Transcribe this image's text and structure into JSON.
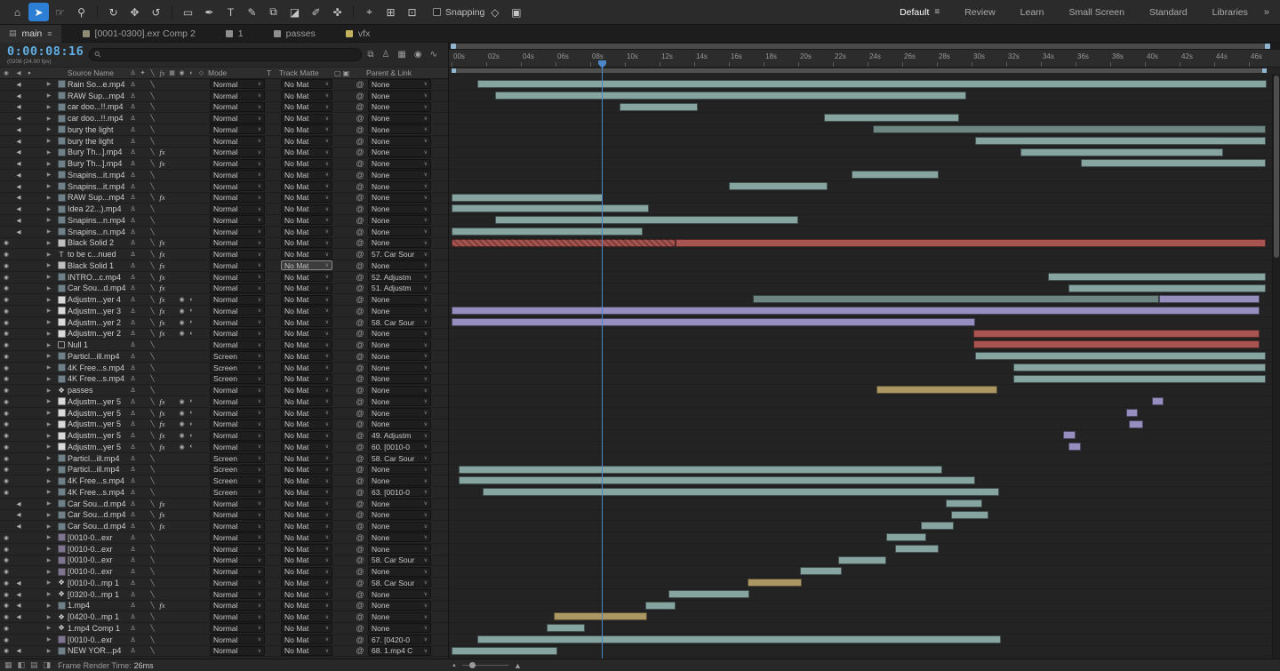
{
  "toolbar": {
    "snapping_label": "Snapping",
    "snapping_checked": false,
    "menu_glyph": "≡",
    "overflow_icon": "»",
    "tools": [
      {
        "name": "home-tool",
        "glyph": "⌂"
      },
      {
        "name": "selection-tool",
        "glyph": "➤",
        "active": true
      },
      {
        "name": "hand-tool",
        "glyph": "☞"
      },
      {
        "name": "zoom-tool",
        "glyph": "⚲"
      },
      {
        "sep": true
      },
      {
        "name": "orbit-camera-tool",
        "glyph": "↻"
      },
      {
        "name": "pan-camera-tool",
        "glyph": "✥"
      },
      {
        "name": "dolly-camera-tool",
        "glyph": "↺"
      },
      {
        "sep": true
      },
      {
        "name": "rectangle-tool",
        "glyph": "▭"
      },
      {
        "name": "pen-tool",
        "glyph": "✒"
      },
      {
        "name": "type-tool",
        "glyph": "T"
      },
      {
        "name": "brush-tool",
        "glyph": "✎"
      },
      {
        "name": "clone-stamp-tool",
        "glyph": "⧉"
      },
      {
        "name": "eraser-tool",
        "glyph": "◪"
      },
      {
        "name": "roto-brush-tool",
        "glyph": "✐"
      },
      {
        "name": "puppet-pin-tool",
        "glyph": "✜"
      },
      {
        "sep": true
      },
      {
        "name": "axis-mode-local",
        "glyph": "⌖"
      },
      {
        "name": "axis-mode-world",
        "glyph": "⊞"
      },
      {
        "name": "axis-mode-view",
        "glyph": "⊡"
      }
    ],
    "post_icons": [
      {
        "name": "snapping-options-icon-1",
        "glyph": "◇"
      },
      {
        "name": "snapping-options-icon-2",
        "glyph": "▣"
      }
    ],
    "workspaces": [
      {
        "label": "Default",
        "active": true
      },
      {
        "label": "Review"
      },
      {
        "label": "Learn"
      },
      {
        "label": "Small Screen"
      },
      {
        "label": "Standard"
      },
      {
        "label": "Libraries"
      }
    ]
  },
  "tabs": {
    "active": {
      "icon_glyph": "▤",
      "label": "main",
      "menu_glyph": "≡"
    },
    "items": [
      {
        "label": "[0001-0300].exr Comp 2",
        "color": "#8F8A74"
      },
      {
        "label": "1",
        "color": "#8F8F8F"
      },
      {
        "label": "passes",
        "color": "#8F8F8F"
      },
      {
        "label": "vfx",
        "color": "#C4B35E"
      }
    ]
  },
  "search": {
    "placeholder": "",
    "magnifier_glyph": "⚲"
  },
  "panel_top_icons": [
    {
      "name": "mini-flowchart-icon",
      "glyph": "⧉"
    },
    {
      "name": "hide-shy-layers-icon",
      "glyph": "♙"
    },
    {
      "name": "frame-blending-icon",
      "glyph": "▦"
    },
    {
      "name": "motion-blur-icon",
      "glyph": "◉"
    },
    {
      "name": "graph-editor-icon",
      "glyph": "∿"
    }
  ],
  "columns": {
    "av_icons": [
      "◉",
      "◀",
      "●"
    ],
    "eye_glyph": "◉",
    "audio_glyph": "◀",
    "source_name": "Source Name",
    "switch_glyphs": {
      "shy": "♙",
      "collapse": "✦",
      "quality": "╲",
      "fx": "fx",
      "frame_blend": "▦",
      "motion_blur": "◉",
      "adjustment": "◐",
      "threed": "◇"
    },
    "mode": "Mode",
    "t": "T",
    "track_matte": "Track Matte",
    "matte_toggle_icons": [
      "▢",
      "▣"
    ],
    "parent_link": "Parent & Link"
  },
  "defaults": {
    "mode": "Normal",
    "track_matte": "No Mat",
    "parent": "None"
  },
  "palette": {
    "clip_green": "#87A5A0",
    "clip_green_dark": "#6E8682",
    "clip_red": "#A85450",
    "clip_purple": "#958EBE",
    "clip_tan": "#AB9763",
    "timecode_blue": "#61AEE3",
    "playhead_blue": "#4E87C7",
    "tool_active_blue": "#2D7FD6"
  },
  "layer_icon_styles": {
    "video": {
      "color": "#6F8089"
    },
    "footage": {
      "color": "#80758F"
    },
    "solid": {
      "color": "#BFBFBF"
    },
    "adjustment": {
      "color": "#DADADA"
    },
    "null": {
      "outline": true
    },
    "text": {
      "glyph": "T"
    },
    "comp": {
      "glyph": "❖"
    }
  },
  "timeline": {
    "timecode": "0:00:08:16",
    "frame_info": "(0208 (24.00 fps)",
    "playhead_seconds": 8.67,
    "duration_seconds": 47,
    "ruler_labels": [
      "00s",
      "02s",
      "04s",
      "06s",
      "08s",
      "10s",
      "12s",
      "14s",
      "16s",
      "18s",
      "20s",
      "22s",
      "24s",
      "26s",
      "28s",
      "30s",
      "32s",
      "34s",
      "36s",
      "38s",
      "40s",
      "42s",
      "44s",
      "46s"
    ],
    "layers": [
      {
        "name": "Rain So...e.mp4",
        "icon": "video",
        "audio": true,
        "clips": [
          {
            "start": 1.5,
            "end": 47,
            "color": "green"
          }
        ]
      },
      {
        "name": "RAW Sup...mp4",
        "icon": "video",
        "audio": true,
        "clips": [
          {
            "start": 2.5,
            "end": 29.7,
            "color": "green"
          }
        ]
      },
      {
        "name": "car doo...!!.mp4",
        "icon": "video",
        "audio": true,
        "clips": [
          {
            "start": 9.7,
            "end": 14.2,
            "color": "green"
          }
        ]
      },
      {
        "name": "car doo...!!.mp4",
        "icon": "video",
        "audio": true,
        "clips": [
          {
            "start": 21.5,
            "end": 29.3,
            "color": "green"
          }
        ]
      },
      {
        "name": "bury the light",
        "icon": "video",
        "audio": true,
        "clips": [
          {
            "start": 24.3,
            "end": 47,
            "color": "green_dark"
          }
        ]
      },
      {
        "name": "bury the light",
        "icon": "video",
        "audio": true,
        "clips": [
          {
            "start": 30.2,
            "end": 47,
            "color": "green"
          }
        ]
      },
      {
        "name": "Bury Th...].mp4",
        "icon": "video",
        "audio": true,
        "fx": true,
        "clips": [
          {
            "start": 32.8,
            "end": 44.5,
            "color": "green"
          }
        ]
      },
      {
        "name": "Bury Th...].mp4",
        "icon": "video",
        "audio": true,
        "fx": true,
        "clips": [
          {
            "start": 36.3,
            "end": 47,
            "color": "green"
          }
        ]
      },
      {
        "name": "Snapins...it.mp4",
        "icon": "video",
        "audio": true,
        "clips": [
          {
            "start": 23.1,
            "end": 28.1,
            "color": "green"
          }
        ]
      },
      {
        "name": "Snapins...it.mp4",
        "icon": "video",
        "audio": true,
        "clips": [
          {
            "start": 16,
            "end": 21.7,
            "color": "green"
          }
        ]
      },
      {
        "name": "RAW Sup...mp4",
        "icon": "video",
        "audio": true,
        "fx": true,
        "clips": [
          {
            "start": 0,
            "end": 8.7,
            "color": "green"
          }
        ]
      },
      {
        "name": "Idea 22...).mp4",
        "icon": "video",
        "audio": true,
        "clips": [
          {
            "start": 0,
            "end": 11.4,
            "color": "green"
          }
        ]
      },
      {
        "name": "Snapins...n.mp4",
        "icon": "video",
        "audio": true,
        "clips": [
          {
            "start": 2.5,
            "end": 20,
            "color": "green"
          }
        ]
      },
      {
        "name": "Snapins...n.mp4",
        "icon": "video",
        "audio": true,
        "clips": [
          {
            "start": 0,
            "end": 11,
            "color": "green"
          }
        ]
      },
      {
        "name": "Black Solid 2",
        "icon": "solid",
        "eye": true,
        "fx": true,
        "clips": [
          {
            "start": 0,
            "end": 12.9,
            "color": "red",
            "hat ched": false,
            "hatched": true
          },
          {
            "start": 12.9,
            "end": 47,
            "color": "red"
          }
        ]
      },
      {
        "name": "to be c...nued",
        "icon": "text",
        "eye": true,
        "fx": true,
        "parent": "57. Car Sour",
        "clips": []
      },
      {
        "name": "Black Solid 1",
        "icon": "solid",
        "eye": true,
        "fx": true,
        "trkmat_highlight": true,
        "clips": []
      },
      {
        "name": "INTRO...c.mp4",
        "icon": "video",
        "eye": true,
        "fx": true,
        "parent": "52. Adjustm",
        "clips": [
          {
            "start": 34.4,
            "end": 47,
            "color": "green"
          }
        ]
      },
      {
        "name": "Car Sou...d.mp4",
        "icon": "video",
        "eye": true,
        "fx": true,
        "parent": "51. Adjustm",
        "clips": [
          {
            "start": 35.6,
            "end": 47,
            "color": "green"
          }
        ]
      },
      {
        "name": "Adjustm...yer 4",
        "icon": "adjustment",
        "eye": true,
        "fx": true,
        "adjustment": true,
        "clips": [
          {
            "start": 17.4,
            "end": 40.8,
            "color": "green_dark"
          },
          {
            "start": 40.8,
            "end": 46.6,
            "color": "purple"
          }
        ]
      },
      {
        "name": "Adjustm...yer 3",
        "icon": "adjustment",
        "eye": true,
        "fx": true,
        "adjustment": true,
        "clips": [
          {
            "start": 0,
            "end": 46.6,
            "color": "purple"
          }
        ]
      },
      {
        "name": "Adjustm...yer 2",
        "icon": "adjustment",
        "eye": true,
        "fx": true,
        "adjustment": true,
        "parent": "58. Car Sour",
        "clips": [
          {
            "start": 0,
            "end": 30.2,
            "color": "purple"
          }
        ]
      },
      {
        "name": "Adjustm...yer 2",
        "icon": "adjustment",
        "eye": true,
        "fx": true,
        "adjustment": true,
        "clips": [
          {
            "start": 30.1,
            "end": 46.6,
            "color": "red"
          }
        ]
      },
      {
        "name": "Null 1",
        "icon": "null",
        "eye": true,
        "clips": [
          {
            "start": 30.1,
            "end": 46.6,
            "color": "red"
          }
        ]
      },
      {
        "name": "Particl...ill.mp4",
        "icon": "video",
        "eye": true,
        "mode": "Screen",
        "clips": [
          {
            "start": 30.2,
            "end": 47,
            "color": "green"
          }
        ]
      },
      {
        "name": "4K Free...s.mp4",
        "icon": "video",
        "eye": true,
        "mode": "Screen",
        "clips": [
          {
            "start": 32.4,
            "end": 47,
            "color": "green"
          }
        ]
      },
      {
        "name": "4K Free...s.mp4",
        "icon": "video",
        "eye": true,
        "mode": "Screen",
        "clips": [
          {
            "start": 32.4,
            "end": 47,
            "color": "green"
          }
        ]
      },
      {
        "name": "passes",
        "icon": "comp",
        "eye": true,
        "clips": [
          {
            "start": 24.5,
            "end": 31.5,
            "color": "tan"
          }
        ]
      },
      {
        "name": "Adjustm...yer 5",
        "icon": "adjustment",
        "eye": true,
        "fx": true,
        "adjustment": true,
        "clips": [
          {
            "start": 40.4,
            "end": 41.1,
            "color": "purple"
          }
        ]
      },
      {
        "name": "Adjustm...yer 5",
        "icon": "adjustment",
        "eye": true,
        "fx": true,
        "adjustment": true,
        "clips": [
          {
            "start": 38.9,
            "end": 39.6,
            "color": "purple"
          }
        ]
      },
      {
        "name": "Adjustm...yer 5",
        "icon": "adjustment",
        "eye": true,
        "fx": true,
        "adjustment": true,
        "clips": [
          {
            "start": 39.1,
            "end": 39.9,
            "color": "purple"
          }
        ]
      },
      {
        "name": "Adjustm...yer 5",
        "icon": "adjustment",
        "eye": true,
        "fx": true,
        "adjustment": true,
        "parent": "49. Adjustm",
        "clips": [
          {
            "start": 35.3,
            "end": 36,
            "color": "purple"
          }
        ]
      },
      {
        "name": "Adjustm...yer 5",
        "icon": "adjustment",
        "eye": true,
        "fx": true,
        "adjustment": true,
        "parent": "60. [0010-0",
        "clips": [
          {
            "start": 35.6,
            "end": 36.3,
            "color": "purple"
          }
        ]
      },
      {
        "name": "Particl...ill.mp4",
        "icon": "video",
        "eye": true,
        "mode": "Screen",
        "parent": "58. Car Sour",
        "clips": []
      },
      {
        "name": "Particl...ill.mp4",
        "icon": "video",
        "eye": true,
        "mode": "Screen",
        "clips": [
          {
            "start": 0.4,
            "end": 28.3,
            "color": "green"
          }
        ]
      },
      {
        "name": "4K Free...s.mp4",
        "icon": "video",
        "eye": true,
        "mode": "Screen",
        "clips": [
          {
            "start": 0.4,
            "end": 30.2,
            "color": "green"
          }
        ]
      },
      {
        "name": "4K Free...s.mp4",
        "icon": "video",
        "eye": true,
        "mode": "Screen",
        "parent": "63. [0010-0",
        "clips": [
          {
            "start": 1.8,
            "end": 31.6,
            "color": "green"
          }
        ]
      },
      {
        "name": "Car Sou...d.mp4",
        "icon": "video",
        "audio": true,
        "fx": true,
        "clips": [
          {
            "start": 28.5,
            "end": 30.6,
            "color": "green"
          }
        ]
      },
      {
        "name": "Car Sou...d.mp4",
        "icon": "video",
        "audio": true,
        "fx": true,
        "clips": [
          {
            "start": 28.8,
            "end": 31,
            "color": "green"
          }
        ]
      },
      {
        "name": "Car Sou...d.mp4",
        "icon": "video",
        "audio": true,
        "fx": true,
        "clips": [
          {
            "start": 27.1,
            "end": 29,
            "color": "green"
          }
        ]
      },
      {
        "name": "[0010-0...exr",
        "icon": "footage",
        "eye": true,
        "clips": [
          {
            "start": 25.1,
            "end": 27.4,
            "color": "green"
          }
        ]
      },
      {
        "name": "[0010-0...exr",
        "icon": "footage",
        "eye": true,
        "clips": [
          {
            "start": 25.6,
            "end": 28.1,
            "color": "green"
          }
        ]
      },
      {
        "name": "[0010-0...exr",
        "icon": "footage",
        "eye": true,
        "parent": "58. Car Sour",
        "clips": [
          {
            "start": 22.3,
            "end": 25.1,
            "color": "green"
          }
        ]
      },
      {
        "name": "[0010-0...exr",
        "icon": "footage",
        "eye": true,
        "clips": [
          {
            "start": 20.1,
            "end": 22.5,
            "color": "green"
          }
        ]
      },
      {
        "name": "[0010-0...mp 1",
        "icon": "comp",
        "eye": true,
        "audio": true,
        "parent": "58. Car Sour",
        "clips": [
          {
            "start": 17.1,
            "end": 20.2,
            "color": "tan"
          }
        ]
      },
      {
        "name": "[0320-0...mp 1",
        "icon": "comp",
        "eye": true,
        "audio": true,
        "clips": [
          {
            "start": 12.5,
            "end": 17.2,
            "color": "green"
          }
        ]
      },
      {
        "name": "1.mp4",
        "icon": "video",
        "eye": true,
        "audio": true,
        "fx": true,
        "clips": [
          {
            "start": 11.2,
            "end": 12.9,
            "color": "green"
          }
        ]
      },
      {
        "name": "[0420-0...mp 1",
        "icon": "comp",
        "eye": true,
        "audio": true,
        "clips": [
          {
            "start": 5.9,
            "end": 11.3,
            "color": "tan"
          }
        ]
      },
      {
        "name": "1.mp4 Comp 1",
        "icon": "comp",
        "eye": true,
        "clips": [
          {
            "start": 5.5,
            "end": 7.7,
            "color": "green"
          }
        ]
      },
      {
        "name": "[0010-0...exr",
        "icon": "footage",
        "eye": true,
        "parent": "67. [0420-0",
        "clips": [
          {
            "start": 1.5,
            "end": 31.7,
            "color": "green"
          }
        ]
      },
      {
        "name": "NEW YOR...p4",
        "icon": "video",
        "eye": true,
        "audio": true,
        "parent": "68. 1.mp4 C",
        "clips": [
          {
            "start": 0,
            "end": 6.1,
            "color": "green"
          }
        ]
      }
    ]
  },
  "status": {
    "icons": [
      {
        "name": "panel-toggle-icon-1",
        "glyph": "▦"
      },
      {
        "name": "panel-toggle-icon-2",
        "glyph": "◧"
      },
      {
        "name": "panel-toggle-icon-3",
        "glyph": "▤"
      },
      {
        "name": "panel-toggle-icon-4",
        "glyph": "◨"
      }
    ],
    "frame_render_label": "Frame Render Time:",
    "frame_render_value": "26ms",
    "zoom_out_icon": "▲",
    "zoom_in_icon": "▲"
  }
}
